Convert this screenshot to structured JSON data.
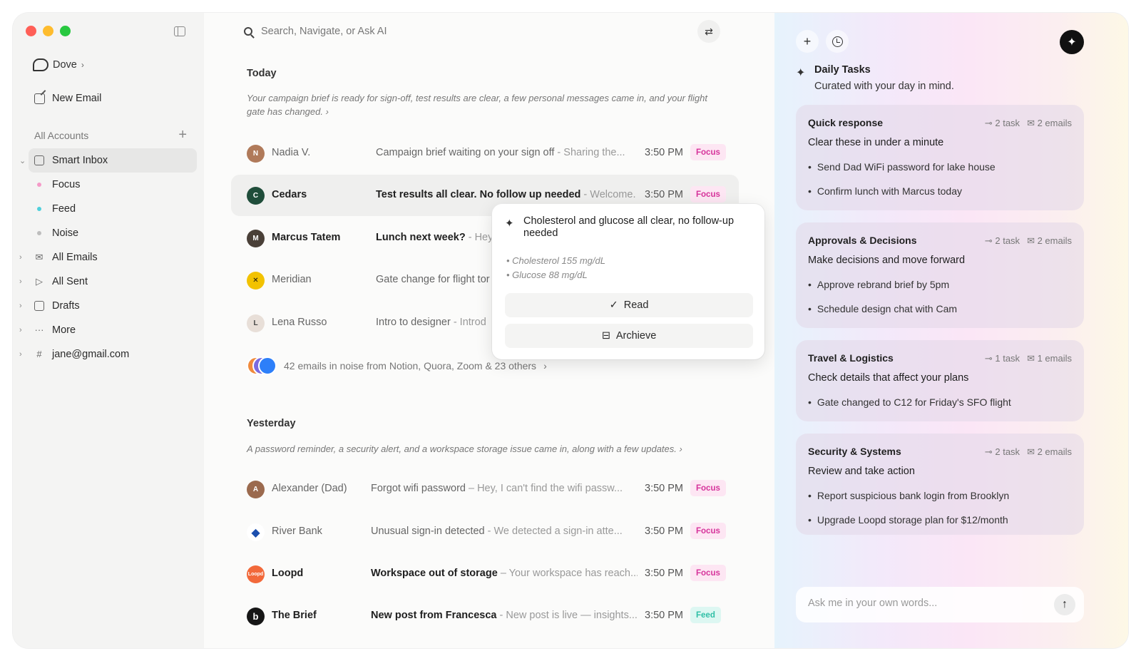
{
  "sidebar": {
    "brand": "Dove",
    "new_email": "New Email",
    "accounts_header": "All Accounts",
    "smart_inbox": "Smart Inbox",
    "sub_items": [
      {
        "label": "Focus",
        "color": "#f59ac8"
      },
      {
        "label": "Feed",
        "color": "#4fd0dc"
      },
      {
        "label": "Noise",
        "color": "#bdbdbd"
      }
    ],
    "items": [
      {
        "label": "All Emails",
        "icon": "envelope-icon"
      },
      {
        "label": "All Sent",
        "icon": "send-icon"
      },
      {
        "label": "Drafts",
        "icon": "drafts-icon"
      },
      {
        "label": "More",
        "icon": "more-icon"
      },
      {
        "label": "jane@gmail.com",
        "icon": "hashtag-icon"
      }
    ]
  },
  "search": {
    "placeholder": "Search, Navigate, or Ask AI"
  },
  "today": {
    "title": "Today",
    "summary": "Your campaign brief is ready for sign-off, test results are clear, a few personal messages came in, and your flight gate has changed.",
    "emails": [
      {
        "sender": "Nadia V.",
        "subject": "Campaign brief waiting on your sign off",
        "preview": " - Sharing the...",
        "time": "3:50 PM",
        "tag": "Focus"
      },
      {
        "sender": "Cedars",
        "subject": "Test results all clear. No follow up needed",
        "preview": " - Welcome...",
        "time": "3:50 PM",
        "tag": "Focus"
      },
      {
        "sender": "Marcus Tatem",
        "subject": "Lunch next week?",
        "preview": " - Hey"
      },
      {
        "sender": "Meridian",
        "subject": "Gate change for flight tor",
        "preview": ""
      },
      {
        "sender": "Lena Russo",
        "subject": "Intro to designer",
        "preview": " - Introd"
      }
    ],
    "noise": "42 emails in noise from Notion, Quora, Zoom & 23 others"
  },
  "yesterday": {
    "title": "Yesterday",
    "summary": "A password reminder, a security alert, and a workspace storage issue came in, along with a few updates.",
    "emails": [
      {
        "sender": "Alexander (Dad)",
        "subject": "Forgot wifi password",
        "preview": "  –  Hey, I can't find the wifi passw...",
        "time": "3:50 PM",
        "tag": "Focus"
      },
      {
        "sender": "River Bank",
        "subject": "Unusual sign-in detected",
        "preview": " - We detected a sign-in atte...",
        "time": "3:50 PM",
        "tag": "Focus"
      },
      {
        "sender": "Loopd",
        "subject": "Workspace out of storage",
        "preview": " – Your workspace has reach...",
        "time": "3:50 PM",
        "tag": "Focus"
      },
      {
        "sender": "The Brief",
        "subject": "New post from Francesca",
        "preview": " - New post is live — insights...",
        "time": "3:50 PM",
        "tag": "Feed"
      }
    ]
  },
  "popover": {
    "title": "Cholesterol and glucose all clear, no follow-up needed",
    "bullets": [
      "• Cholesterol 155 mg/dL",
      "• Glucose 88 mg/dL"
    ],
    "read": "Read",
    "archive": "Archieve"
  },
  "daily_tasks": {
    "title": "Daily Tasks",
    "subtitle": "Curated with your day in mind.",
    "cards": [
      {
        "title": "Quick response",
        "tasks": "2 task",
        "emails": "2 emails",
        "subtitle": "Clear these in under a minute",
        "items": [
          "Send Dad WiFi password for lake house",
          "Confirm lunch with Marcus today"
        ]
      },
      {
        "title": "Approvals & Decisions",
        "tasks": "2 task",
        "emails": "2 emails",
        "subtitle": "Make decisions and move forward",
        "items": [
          "Approve rebrand brief by 5pm",
          "Schedule design chat with Cam"
        ]
      },
      {
        "title": "Travel & Logistics",
        "tasks": "1 task",
        "emails": "1 emails",
        "subtitle": "Check details that affect your plans",
        "items": [
          "Gate changed to C12 for Friday's SFO flight"
        ]
      },
      {
        "title": "Security & Systems",
        "tasks": "2 task",
        "emails": "2 emails",
        "subtitle": "Review and take action",
        "items": [
          "Report suspicious bank login from Brooklyn",
          "Upgrade Loopd storage plan for $12/month"
        ]
      }
    ],
    "ask_placeholder": "Ask me in your own words..."
  },
  "colors": {
    "focus_tag": "#d6339b",
    "feed_tag": "#2fbfa6",
    "accent_dark": "#111111"
  }
}
